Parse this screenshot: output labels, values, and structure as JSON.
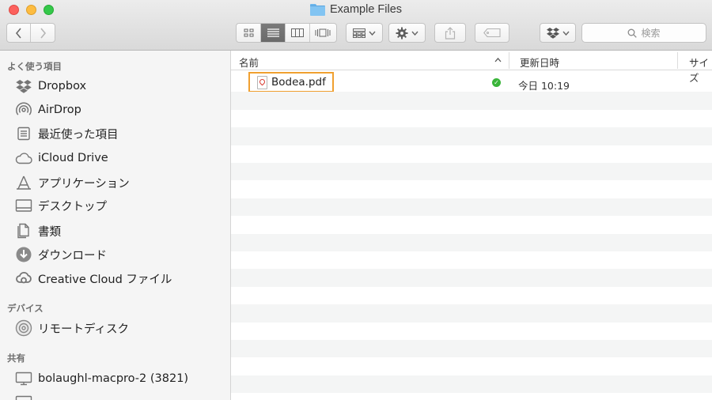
{
  "window": {
    "title": "Example Files"
  },
  "toolbar": {
    "search_placeholder": "検索"
  },
  "sidebar": {
    "favorites_header": "よく使う項目",
    "favorites": [
      {
        "label": "Dropbox",
        "icon": "dropbox-icon"
      },
      {
        "label": "AirDrop",
        "icon": "airdrop-icon"
      },
      {
        "label": "最近使った項目",
        "icon": "recents-icon"
      },
      {
        "label": "iCloud Drive",
        "icon": "cloud-icon"
      },
      {
        "label": "アプリケーション",
        "icon": "applications-icon"
      },
      {
        "label": "デスクトップ",
        "icon": "desktop-icon"
      },
      {
        "label": "書類",
        "icon": "documents-icon"
      },
      {
        "label": "ダウンロード",
        "icon": "downloads-icon"
      },
      {
        "label": "Creative Cloud ファイル",
        "icon": "creative-cloud-icon"
      }
    ],
    "devices_header": "デバイス",
    "devices": [
      {
        "label": "リモートディスク",
        "icon": "remote-disc-icon"
      }
    ],
    "shared_header": "共有",
    "shared": [
      {
        "label": "bolaughl-macpro-2 (3821)",
        "icon": "computer-icon"
      }
    ]
  },
  "list": {
    "columns": {
      "name": "名前",
      "modified": "更新日時",
      "size": "サイズ"
    },
    "files": [
      {
        "name": "Bodea.pdf",
        "modified": "今日 10:19",
        "status": "synced"
      }
    ]
  },
  "colors": {
    "highlight_border": "#f0a030",
    "sync_ok": "#3ab53a"
  }
}
